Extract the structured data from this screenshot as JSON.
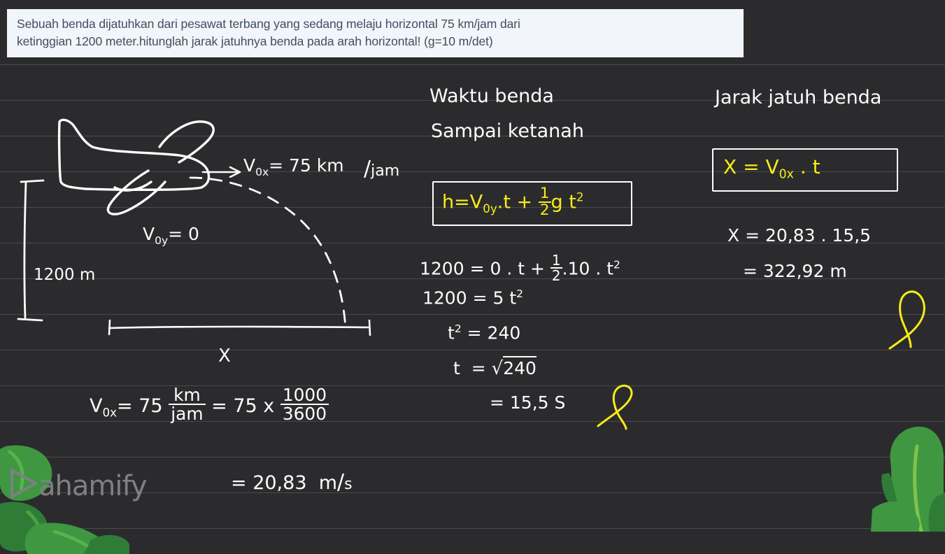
{
  "page": {
    "background_color": "#2b2b2d",
    "rule_line_color": "#4a4a4c",
    "ink_color": "#fdfdfd",
    "highlight_color": "#f7ec18",
    "plant_color": "#3f9741"
  },
  "question": {
    "line1": "Sebuah benda dijatuhkan dari pesawat terbang yang sedang melaju horizontal 75 km/jam dari",
    "line2": "ketinggian 1200 meter.hitunglah jarak jatuhnya benda pada arah horizontal! (g=10 m/det)",
    "background_color": "#f2f5f9",
    "text_color": "#414f61"
  },
  "diagram": {
    "velocity_label_v0x": "V",
    "velocity_label_v0x_sub": "0x",
    "velocity_label_v0x_value": "= 75  km",
    "velocity_label_v0x_unit_num": "km",
    "velocity_label_v0x_unit_den": "jam",
    "voy_label": "V",
    "voy_sub": "0y",
    "voy_value": "= 0",
    "height_label": "1200 m",
    "distance_label": "X",
    "plane_icon": "airplane-sketch"
  },
  "column_time": {
    "heading_line1": "Waktu benda",
    "heading_line2": "Sampai ketanah",
    "formula": {
      "lhs": "h=",
      "term1_v": "V",
      "term1_sub": "0y",
      "term1_rest": ".t +",
      "half_num": "1",
      "half_den": "2",
      "term2": "g t",
      "term2_exp": "2"
    },
    "steps": [
      {
        "lhs": "1200 =",
        "rhs_a": "0 . t +",
        "half_num": "1",
        "half_den": "2",
        "rhs_b": ".10 . t",
        "exp": "2"
      },
      {
        "lhs": "1200 =",
        "rhs": "5 t",
        "exp": "2"
      },
      {
        "lhs": "t",
        "lhs_exp": "2",
        "rhs": "= 240"
      },
      {
        "lhs": "t",
        "rhs": "=",
        "sqrt": "240"
      },
      {
        "lhs": "",
        "rhs": "= 15,5  S"
      }
    ]
  },
  "column_distance": {
    "heading": "Jarak jatuh benda",
    "formula": {
      "lhs": "X =",
      "v": "V",
      "sub": "0x",
      "rest": ". t"
    },
    "steps": [
      "X = 20,83  .  15,5",
      "= 322,92  m"
    ]
  },
  "column_velocity": {
    "lhs_v": "V",
    "lhs_sub": "0x",
    "eq1": "= 75",
    "unit_num": "km",
    "unit_den": "jam",
    "eq2": "= 75 x",
    "frac_num": "1000",
    "frac_den": "3600",
    "result_eq": "=  20,83",
    "result_unit_num": "m",
    "result_unit_den": "s"
  },
  "branding": {
    "wordmark": "ahamify",
    "logo_icon": "play-triangle-logo",
    "logo_color": "#7e8084"
  },
  "decorations": {
    "left_plant": "leaf-cluster-left",
    "right_plant": "leaf-cluster-right",
    "yellow_flourish": "yellow-pen-flourish"
  }
}
